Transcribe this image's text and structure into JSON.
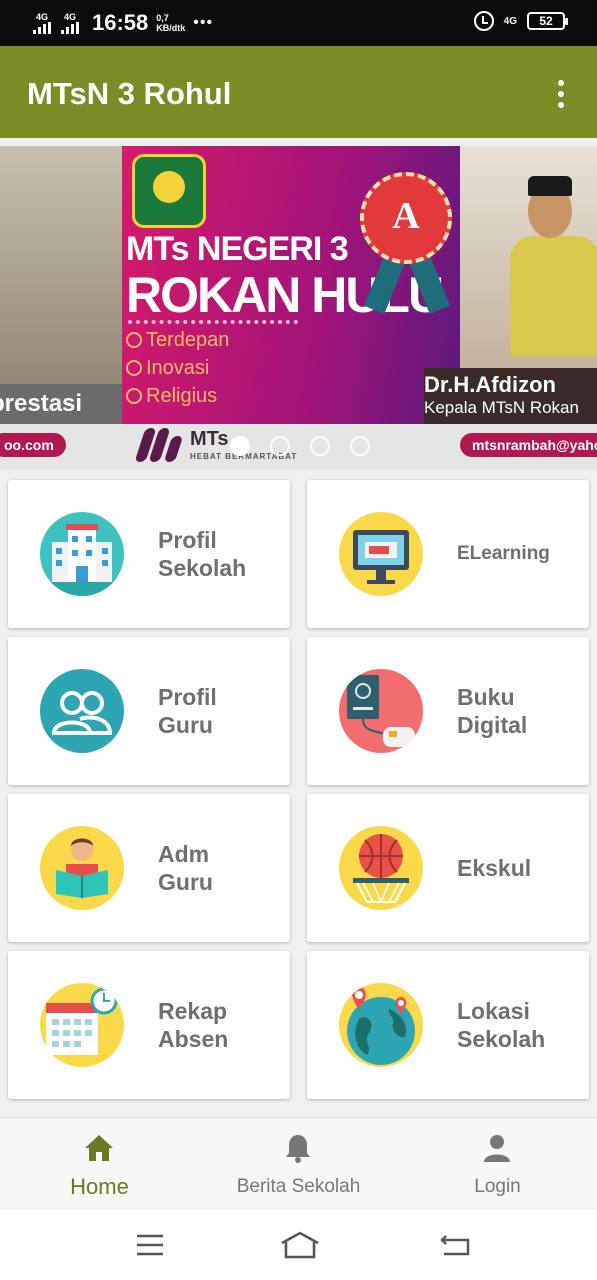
{
  "status_bar": {
    "sim1": "4G",
    "sim2": "4G",
    "time": "16:58",
    "speed_value": "0,7",
    "speed_unit": "KB/dtk",
    "more": "•••",
    "network": "4G",
    "battery": "52"
  },
  "app_bar": {
    "title": "MTsN 3 Rohul",
    "menu_icon": "overflow-menu-icon"
  },
  "banner": {
    "left_caption": "prestasi",
    "heading_line1": "MTs  NEGERI 3",
    "heading_line2": "ROKAN HULU",
    "slogans": [
      "Terdepan",
      "Inovasi",
      "Religius"
    ],
    "accreditation_grade": "A",
    "person_name": "Dr.H.Afdizon",
    "person_role": "Kepala MTsN Rokan",
    "email_left": "oo.com",
    "email_right": "mtsnrambah@yaho",
    "logo_word": "MTs",
    "logo_tagline": "HEBAT BERMARTABAT",
    "page_count": 4,
    "active_page": 1
  },
  "menu": [
    {
      "line1": "Profil",
      "line2": "Sekolah",
      "icon": "school-building-icon"
    },
    {
      "line1": "ELearning",
      "line2": "",
      "icon": "monitor-icon"
    },
    {
      "line1": "Profil",
      "line2": "Guru",
      "icon": "people-icon"
    },
    {
      "line1": "Buku",
      "line2": "Digital",
      "icon": "ebook-icon"
    },
    {
      "line1": "Adm",
      "line2": "Guru",
      "icon": "teacher-reading-icon"
    },
    {
      "line1": "Ekskul",
      "line2": "",
      "icon": "basketball-icon"
    },
    {
      "line1": "Rekap",
      "line2": "Absen",
      "icon": "calendar-clock-icon"
    },
    {
      "line1": "Lokasi",
      "line2": "Sekolah",
      "icon": "globe-location-icon"
    }
  ],
  "bottom_nav": [
    {
      "label": "Home",
      "icon": "home-icon",
      "active": true
    },
    {
      "label": "Berita Sekolah",
      "icon": "bell-icon",
      "active": false
    },
    {
      "label": "Login",
      "icon": "user-icon",
      "active": false
    }
  ],
  "system_nav": [
    "menu-lines-icon",
    "home-outline-icon",
    "back-icon"
  ],
  "colors": {
    "app_bar": "#7b8c27",
    "active_nav": "#6b7a22",
    "card_label": "#6f6f6f"
  }
}
